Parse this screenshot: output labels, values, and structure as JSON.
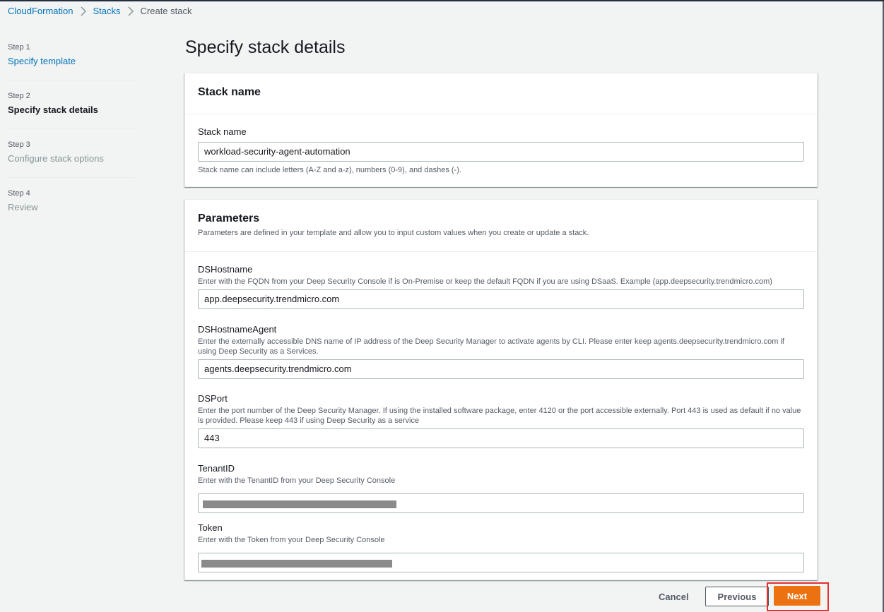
{
  "breadcrumb": {
    "items": [
      "CloudFormation",
      "Stacks"
    ],
    "current": "Create stack"
  },
  "steps": [
    {
      "num": "Step 1",
      "label": "Specify template"
    },
    {
      "num": "Step 2",
      "label": "Specify stack details"
    },
    {
      "num": "Step 3",
      "label": "Configure stack options"
    },
    {
      "num": "Step 4",
      "label": "Review"
    }
  ],
  "page_title": "Specify stack details",
  "stack_panel": {
    "title": "Stack name",
    "field_label": "Stack name",
    "value": "workload-security-agent-automation",
    "constraint": "Stack name can include letters (A-Z and a-z), numbers (0-9), and dashes (-)."
  },
  "params_panel": {
    "title": "Parameters",
    "description": "Parameters are defined in your template and allow you to input custom values when you create or update a stack.",
    "fields": [
      {
        "label": "DSHostname",
        "description": "Enter with the FQDN from your Deep Security Console if is On-Premise or keep the default FQDN if you are using DSaaS. Example (app.deepsecurity.trendmicro.com)",
        "value": "app.deepsecurity.trendmicro.com"
      },
      {
        "label": "DSHostnameAgent",
        "description": "Enter the externally accessible DNS name of IP address of the Deep Security Manager to activate agents by CLI. Please enter keep agents.deepsecurity.trendmicro.com if using Deep Security as a Services.",
        "value": "agents.deepsecurity.trendmicro.com"
      },
      {
        "label": "DSPort",
        "description": "Enter the port number of the Deep Security Manager. If using the installed software package, enter 4120 or the port accessible externally. Port 443 is used as default if no value is provided. Please keep 443 if using Deep Security as a service",
        "value": "443"
      },
      {
        "label": "TenantID",
        "description": "Enter with the TenantID from your Deep Security Console",
        "value": ""
      },
      {
        "label": "Token",
        "description": "Enter with the Token from your Deep Security Console",
        "value": ""
      }
    ]
  },
  "footer": {
    "cancel": "Cancel",
    "previous": "Previous",
    "next": "Next"
  },
  "colors": {
    "link": "#0073bb",
    "primary_button": "#ec7211",
    "highlight": "#e8312f"
  }
}
